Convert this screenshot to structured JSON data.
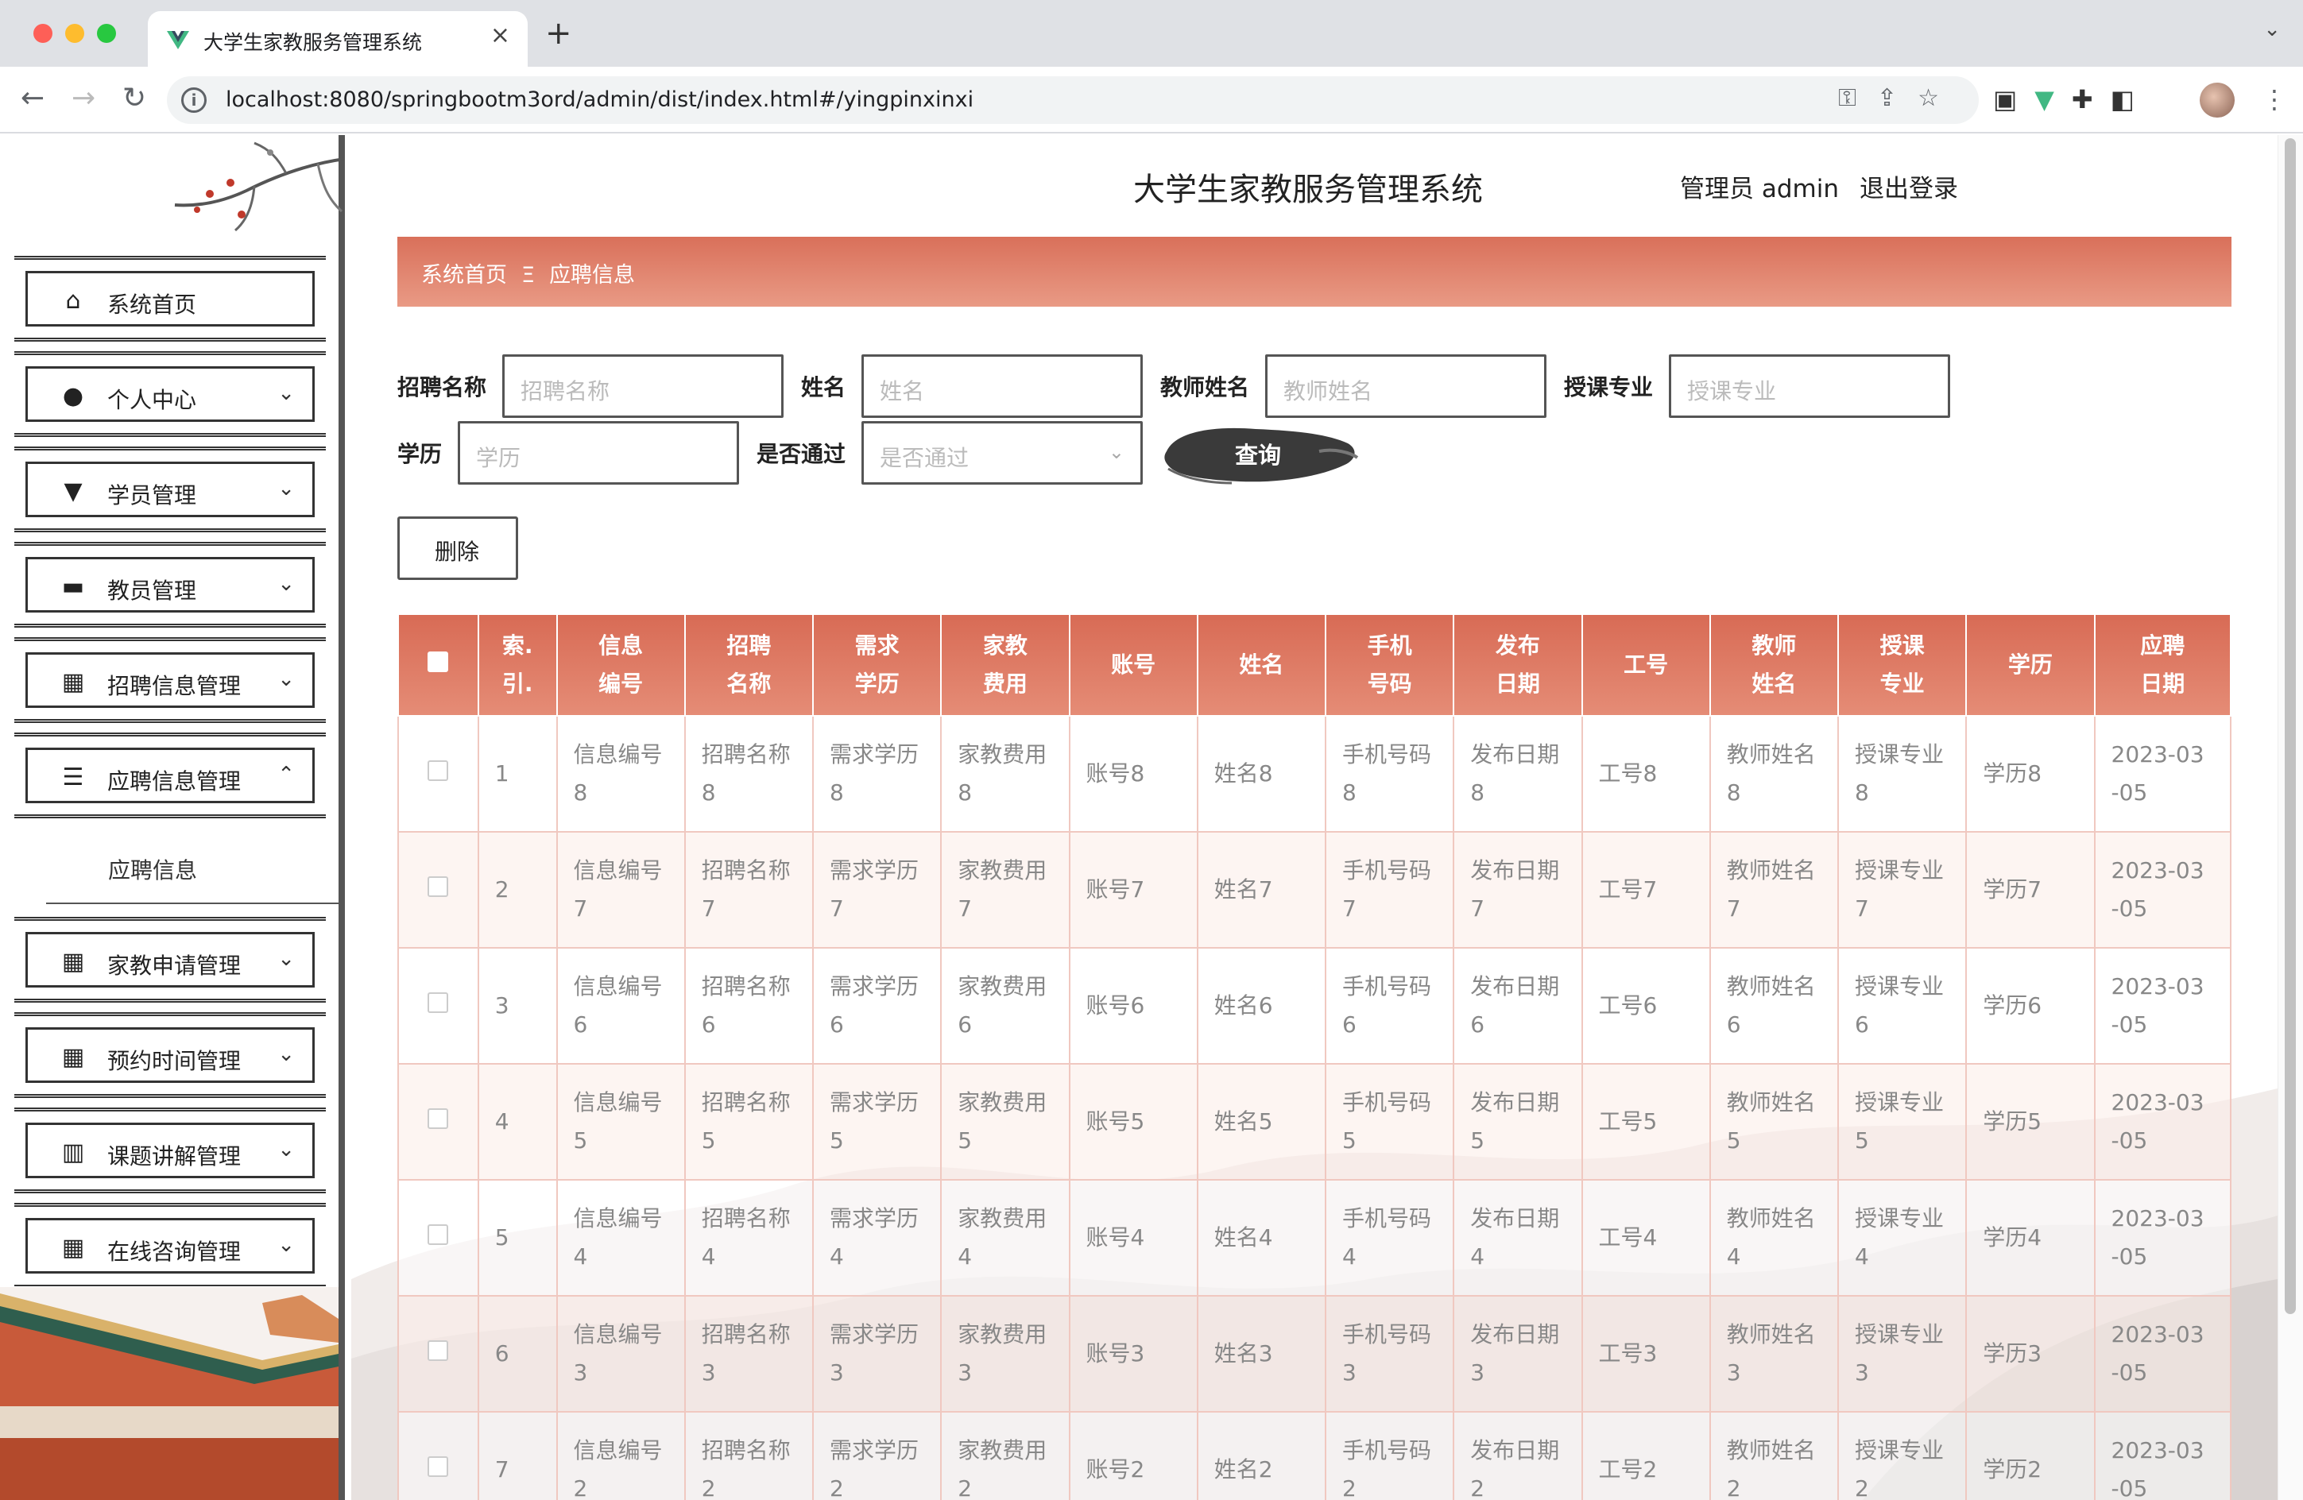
{
  "browser": {
    "tab_title": "大学生家教服务管理系统",
    "url": "localhost:8080/springbootm3ord/admin/dist/index.html#/yingpinxinxi"
  },
  "header": {
    "site_title": "大学生家教服务管理系统",
    "role": "管理员 admin",
    "logout": "退出登录"
  },
  "sidebar": {
    "items": [
      {
        "label": "系统首页",
        "icon": "home-icon",
        "caret": ""
      },
      {
        "label": "个人中心",
        "icon": "user-icon",
        "caret": "⌄"
      },
      {
        "label": "学员管理",
        "icon": "brush-icon",
        "caret": "⌄"
      },
      {
        "label": "教员管理",
        "icon": "monitor-icon",
        "caret": "⌄"
      },
      {
        "label": "招聘信息管理",
        "icon": "grid-icon",
        "caret": "⌄"
      },
      {
        "label": "应聘信息管理",
        "icon": "sliders-icon",
        "caret": "⌃"
      },
      {
        "label": "家教申请管理",
        "icon": "grid-icon",
        "caret": "⌄"
      },
      {
        "label": "预约时间管理",
        "icon": "grid-icon",
        "caret": "⌄"
      },
      {
        "label": "课题讲解管理",
        "icon": "chart-icon",
        "caret": "⌄"
      },
      {
        "label": "在线咨询管理",
        "icon": "grid-icon",
        "caret": "⌄"
      }
    ],
    "sub_item": "应聘信息"
  },
  "breadcrumb": {
    "home": "系统首页",
    "separator": "Ξ",
    "current": "应聘信息"
  },
  "filters": {
    "recruit_name_label": "招聘名称",
    "recruit_name_placeholder": "招聘名称",
    "name_label": "姓名",
    "name_placeholder": "姓名",
    "teacher_name_label": "教师姓名",
    "teacher_name_placeholder": "教师姓名",
    "major_label": "授课专业",
    "major_placeholder": "授课专业",
    "education_label": "学历",
    "education_placeholder": "学历",
    "passed_label": "是否通过",
    "passed_placeholder": "是否通过",
    "query_button": "查询"
  },
  "actions": {
    "delete_button": "删除"
  },
  "table": {
    "headers": [
      [
        "索.",
        "引."
      ],
      [
        "信息",
        "编号"
      ],
      [
        "招聘",
        "名称"
      ],
      [
        "需求",
        "学历"
      ],
      [
        "家教",
        "费用"
      ],
      [
        "账号"
      ],
      [
        "姓名"
      ],
      [
        "手机",
        "号码"
      ],
      [
        "发布",
        "日期"
      ],
      [
        "工号"
      ],
      [
        "教师",
        "姓名"
      ],
      [
        "授课",
        "专业"
      ],
      [
        "学历"
      ],
      [
        "应聘",
        "日期"
      ]
    ],
    "rows": [
      [
        "1",
        "信息编号\n8",
        "招聘名称\n8",
        "需求学历\n8",
        "家教费用\n8",
        "账号8",
        "姓名8",
        "手机号码\n8",
        "发布日期\n8",
        "工号8",
        "教师姓名\n8",
        "授课专业\n8",
        "学历8",
        "2023-03\n-05"
      ],
      [
        "2",
        "信息编号\n7",
        "招聘名称\n7",
        "需求学历\n7",
        "家教费用\n7",
        "账号7",
        "姓名7",
        "手机号码\n7",
        "发布日期\n7",
        "工号7",
        "教师姓名\n7",
        "授课专业\n7",
        "学历7",
        "2023-03\n-05"
      ],
      [
        "3",
        "信息编号\n6",
        "招聘名称\n6",
        "需求学历\n6",
        "家教费用\n6",
        "账号6",
        "姓名6",
        "手机号码\n6",
        "发布日期\n6",
        "工号6",
        "教师姓名\n6",
        "授课专业\n6",
        "学历6",
        "2023-03\n-05"
      ],
      [
        "4",
        "信息编号\n5",
        "招聘名称\n5",
        "需求学历\n5",
        "家教费用\n5",
        "账号5",
        "姓名5",
        "手机号码\n5",
        "发布日期\n5",
        "工号5",
        "教师姓名\n5",
        "授课专业\n5",
        "学历5",
        "2023-03\n-05"
      ],
      [
        "5",
        "信息编号\n4",
        "招聘名称\n4",
        "需求学历\n4",
        "家教费用\n4",
        "账号4",
        "姓名4",
        "手机号码\n4",
        "发布日期\n4",
        "工号4",
        "教师姓名\n4",
        "授课专业\n4",
        "学历4",
        "2023-03\n-05"
      ],
      [
        "6",
        "信息编号\n3",
        "招聘名称\n3",
        "需求学历\n3",
        "家教费用\n3",
        "账号3",
        "姓名3",
        "手机号码\n3",
        "发布日期\n3",
        "工号3",
        "教师姓名\n3",
        "授课专业\n3",
        "学历3",
        "2023-03\n-05"
      ],
      [
        "7",
        "信息编号\n2",
        "招聘名称\n2",
        "需求学历\n2",
        "家教费用\n2",
        "账号2",
        "姓名2",
        "手机号码\n2",
        "发布日期\n2",
        "工号2",
        "教师姓名\n2",
        "授课专业\n2",
        "学历2",
        "2023-03\n-05"
      ]
    ]
  },
  "colors": {
    "accent": "#d86b55",
    "accent_light": "#e99a85",
    "sidebar_border": "#333333"
  }
}
